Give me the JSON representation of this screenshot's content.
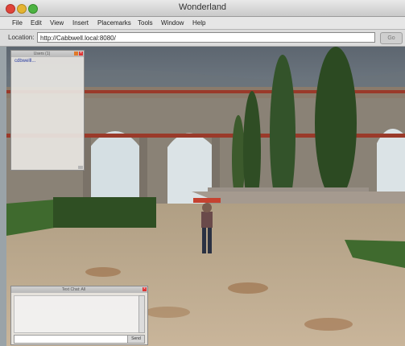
{
  "window": {
    "title": "Wonderland"
  },
  "menu": [
    "File",
    "Edit",
    "View",
    "Insert",
    "Placemarks",
    "Tools",
    "Window",
    "Help"
  ],
  "location": {
    "label": "Location:",
    "url": "http://Cabbwell.local:8080/",
    "go_label": "Go"
  },
  "users_panel": {
    "title": "Users (1)",
    "users": [
      "cdbwelll..."
    ]
  },
  "chat_panel": {
    "title": "Text Chat: All",
    "send_label": "Send",
    "input_value": ""
  }
}
